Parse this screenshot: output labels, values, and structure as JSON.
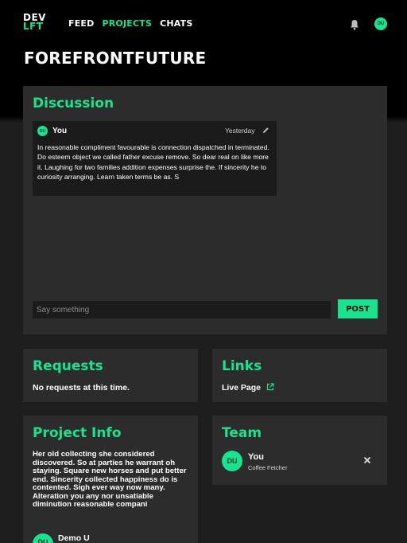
{
  "logo": {
    "line1": "DEV",
    "line2": "LFT"
  },
  "nav": {
    "feed": "FEED",
    "projects": "PROJECTS",
    "chats": "CHATS"
  },
  "user": {
    "initials": "DU"
  },
  "page": {
    "title": "FOREFRONTFUTURE"
  },
  "discussion": {
    "title": "Discussion",
    "messages": [
      {
        "initials": "DU",
        "author": "You",
        "time": "Yesterday",
        "body": "In reasonable compliment favourable is connection dispatched in terminated. Do esteem object we called father excuse remove. So dear real on like more it. Laughing for two families addition expenses surprise the. If sincerity he to curiosity arranging. Learn taken terms be as. S"
      }
    ],
    "input_placeholder": "Say something",
    "post_label": "POST"
  },
  "requests": {
    "title": "Requests",
    "empty_text": "No requests at this time."
  },
  "links": {
    "title": "Links",
    "items": [
      {
        "label": "Live Page"
      }
    ]
  },
  "project_info": {
    "title": "Project Info",
    "description": "Her old collecting she considered discovered. So at parties he warrant oh staying. Square new horses and put better end. Sincerity collected happiness do is contented. Sigh ever way now many. Alteration you any nor unsatiable diminution reasonable compani",
    "owner_initials": "DU",
    "owner_name": "Demo U"
  },
  "team": {
    "title": "Team",
    "members": [
      {
        "initials": "DU",
        "name": "You",
        "role": "Coffee Fetcher"
      }
    ]
  },
  "colors": {
    "accent": "#19e38f",
    "background": "#1e1e1e",
    "card": "#2c2c2c",
    "header": "#000000"
  },
  "icons": {
    "notifications": "bell-icon",
    "edit": "pencil-icon",
    "external": "external-link-icon",
    "remove": "close-icon"
  }
}
